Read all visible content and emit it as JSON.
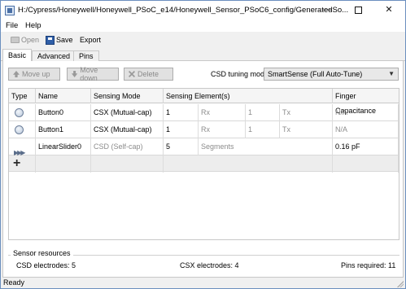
{
  "window": {
    "title": "H:/Cypress/Honeywell/Honeywell_PSoC_e14/Honeywell_Sensor_PSoC6_config/GeneratedSo...",
    "controls": {
      "minimize": "—",
      "maximize": "",
      "close": "✕"
    }
  },
  "menu": {
    "file": "File",
    "help": "Help"
  },
  "toolbar": {
    "open": "Open",
    "save": "Save",
    "export": "Export"
  },
  "tabs": [
    {
      "label": "Basic",
      "active": true
    },
    {
      "label": "Advanced",
      "active": false
    },
    {
      "label": "Pins",
      "active": false
    }
  ],
  "actions": {
    "move_up": "Move up",
    "move_down": "Move down",
    "delete": "Delete"
  },
  "tuning": {
    "label": "CSD tuning mode:",
    "value": "SmartSense (Full Auto-Tune)"
  },
  "table": {
    "headers": [
      "Type",
      "Name",
      "Sensing Mode",
      "Sensing Element(s)",
      "Finger Capacitance"
    ],
    "rows": [
      {
        "type_icon": "button-icon",
        "name": "Button0",
        "mode": "CSX (Mutual-cap)",
        "count": "1",
        "rx_label": "Rx",
        "tx_count": "1",
        "tx_label": "Tx",
        "finger_cap": "N/A"
      },
      {
        "type_icon": "button-icon",
        "name": "Button1",
        "mode": "CSX (Mutual-cap)",
        "count": "1",
        "rx_label": "Rx",
        "tx_count": "1",
        "tx_label": "Tx",
        "finger_cap": "N/A"
      },
      {
        "type_icon": "linear-slider-icon",
        "name": "LinearSlider0",
        "mode": "CSD (Self-cap)",
        "count": "5",
        "segments_label": "Segments",
        "finger_cap": "0.16 pF"
      }
    ],
    "add_icon": "plus-icon"
  },
  "resources": {
    "title": "Sensor resources",
    "csd": "CSD electrodes:  5",
    "csx": "CSX electrodes:  4",
    "pins": "Pins required:  11"
  },
  "status": {
    "text": "Ready"
  }
}
